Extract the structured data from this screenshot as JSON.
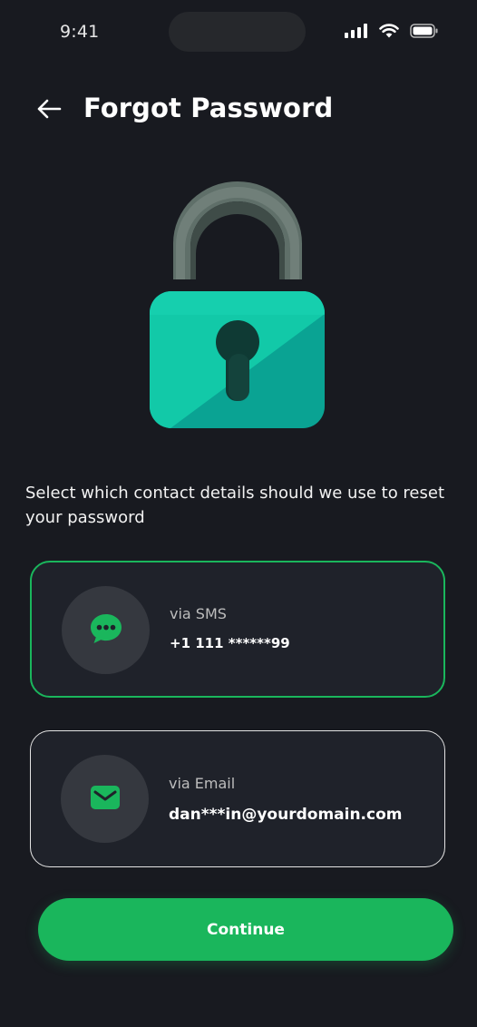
{
  "status_bar": {
    "time": "9:41"
  },
  "header": {
    "title": "Forgot Password",
    "back_icon": "arrow-left-icon"
  },
  "illustration": {
    "icon": "padlock-icon",
    "colors": {
      "shackle": "#5c6c66",
      "body_light": "#12c9a8",
      "body_dark": "#0aa393",
      "keyhole": "#0f3a34"
    }
  },
  "instruction": "Select which contact details should we use to reset your password",
  "options": [
    {
      "id": "sms",
      "icon": "chat-bubble-icon",
      "method": "via SMS",
      "value": "+1 111 ******99",
      "selected": true
    },
    {
      "id": "email",
      "icon": "envelope-icon",
      "method": "via Email",
      "value": "dan***in@yourdomain.com",
      "selected": false
    }
  ],
  "continue_label": "Continue",
  "colors": {
    "background": "#181a20",
    "card": "#1f222a",
    "accent": "#1ab65c",
    "icon_circle": "#35383f"
  }
}
